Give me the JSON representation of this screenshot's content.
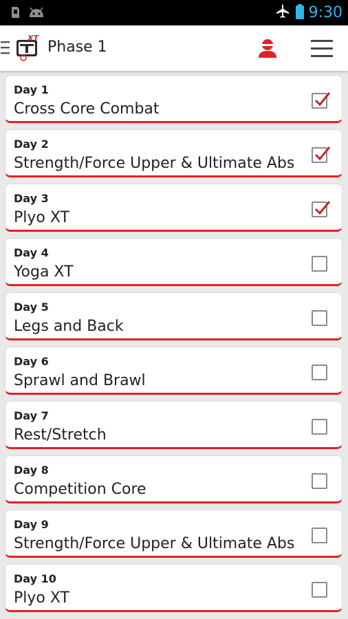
{
  "status_bar": {
    "time": "9:30",
    "icons": [
      "sd-card-icon",
      "android-icon",
      "airplane-mode-icon",
      "battery-icon"
    ]
  },
  "action_bar": {
    "logo": "tapout-xt-logo",
    "logo_text": "XT",
    "title": "Phase 1",
    "profile_icon": "profile-icon",
    "menu_icon": "menu-icon"
  },
  "colors": {
    "accent": "#e32026",
    "check_mark": "#c1272d",
    "status_text": "#33b5e5"
  },
  "days": [
    {
      "day": "Day 1",
      "workout": "Cross Core Combat",
      "completed": true
    },
    {
      "day": "Day 2",
      "workout": "Strength/Force Upper & Ultimate Abs",
      "completed": true
    },
    {
      "day": "Day 3",
      "workout": "Plyo XT",
      "completed": true
    },
    {
      "day": "Day 4",
      "workout": "Yoga XT",
      "completed": false
    },
    {
      "day": "Day 5",
      "workout": "Legs and Back",
      "completed": false
    },
    {
      "day": "Day 6",
      "workout": "Sprawl and Brawl",
      "completed": false
    },
    {
      "day": "Day 7",
      "workout": "Rest/Stretch",
      "completed": false
    },
    {
      "day": "Day 8",
      "workout": "Competition Core",
      "completed": false
    },
    {
      "day": "Day 9",
      "workout": "Strength/Force Upper & Ultimate Abs",
      "completed": false
    },
    {
      "day": "Day 10",
      "workout": "Plyo XT",
      "completed": false
    }
  ]
}
